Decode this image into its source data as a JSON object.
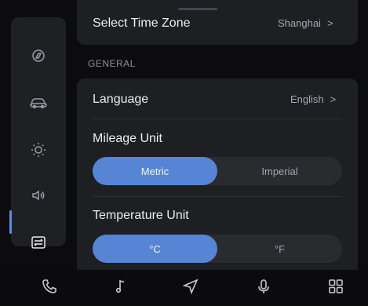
{
  "sidebar": {
    "items": [
      {
        "name": "general-icon"
      },
      {
        "name": "car-icon"
      },
      {
        "name": "brightness-icon"
      },
      {
        "name": "volume-icon"
      },
      {
        "name": "system-settings-icon"
      }
    ],
    "active_index": 4
  },
  "timezone": {
    "label": "Select Time Zone",
    "value": "Shanghai"
  },
  "section_general": "GENERAL",
  "language": {
    "label": "Language",
    "value": "English"
  },
  "mileage": {
    "label": "Mileage Unit",
    "options": [
      "Metric",
      "Imperial"
    ],
    "selected": "Metric"
  },
  "temperature": {
    "label": "Temperature Unit",
    "options": [
      "°C",
      "°F"
    ],
    "selected": "°C"
  },
  "bottom_nav": [
    "phone-icon",
    "music-icon",
    "navigation-icon",
    "microphone-icon",
    "apps-grid-icon"
  ],
  "colors": {
    "accent": "#5585d4",
    "background": "#0c0c0e",
    "card": "#1e1f22"
  }
}
